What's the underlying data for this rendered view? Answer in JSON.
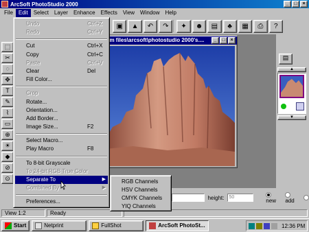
{
  "window": {
    "title": "ArcSoft PhotoStudio 2000",
    "controls": [
      "_",
      "□",
      "×"
    ]
  },
  "menubar": {
    "items": [
      "File",
      "Edit",
      "Select",
      "Layer",
      "Enhance",
      "Effects",
      "View",
      "Window",
      "Help"
    ],
    "active_index": 1
  },
  "edit_menu": {
    "items": [
      {
        "label": "Undo",
        "shortcut": "Ctrl+Z",
        "enabled": false
      },
      {
        "label": "Redo",
        "shortcut": "Ctrl+Y",
        "enabled": false
      },
      {
        "separator": true
      },
      {
        "label": "Cut",
        "shortcut": "Ctrl+X",
        "enabled": true
      },
      {
        "label": "Copy",
        "shortcut": "Ctrl+C",
        "enabled": true
      },
      {
        "label": "Paste",
        "shortcut": "Ctrl+V",
        "enabled": false
      },
      {
        "label": "Clear",
        "shortcut": "Del",
        "enabled": true
      },
      {
        "label": "Fill Color...",
        "shortcut": "",
        "enabled": true
      },
      {
        "separator": true
      },
      {
        "label": "Crop",
        "shortcut": "",
        "enabled": false
      },
      {
        "label": "Rotate...",
        "shortcut": "",
        "enabled": true
      },
      {
        "label": "Orientation...",
        "shortcut": "",
        "enabled": true
      },
      {
        "label": "Add Border...",
        "shortcut": "",
        "enabled": true
      },
      {
        "label": "Image Size...",
        "shortcut": "F2",
        "enabled": true
      },
      {
        "separator": true
      },
      {
        "label": "Select Macro...",
        "shortcut": "",
        "enabled": true
      },
      {
        "label": "Play Macro",
        "shortcut": "F8",
        "enabled": true
      },
      {
        "separator": true
      },
      {
        "label": "To 8-bit Grayscale",
        "shortcut": "",
        "enabled": true
      },
      {
        "label": "To 24-bit RGB True Color",
        "shortcut": "",
        "enabled": false
      },
      {
        "label": "Separate To",
        "shortcut": "",
        "enabled": true,
        "submenu": true,
        "highlighted": true
      },
      {
        "label": "Combined By",
        "shortcut": "",
        "enabled": false,
        "submenu": true
      },
      {
        "separator": true
      },
      {
        "label": "Preferences...",
        "shortcut": "",
        "enabled": true
      }
    ]
  },
  "submenu": {
    "items": [
      "RGB Channels",
      "HSV Channels",
      "CMYK Channels",
      "YIQ Channels"
    ]
  },
  "image_window": {
    "title": "am files\\arcsoft\\photostudio 2000's...."
  },
  "bottom": {
    "height_label": "height:",
    "height_value": "50",
    "radio_new": "new",
    "radio_add": "add"
  },
  "statusbar": {
    "view": "View 1:2",
    "status": "Ready"
  },
  "taskbar": {
    "start": "Start",
    "tasks": [
      {
        "label": "Netprint",
        "pressed": false
      },
      {
        "label": "FullShot",
        "pressed": false
      },
      {
        "label": "ArcSoft PhotoSt...",
        "pressed": true
      }
    ],
    "clock": "12:36 PM"
  }
}
